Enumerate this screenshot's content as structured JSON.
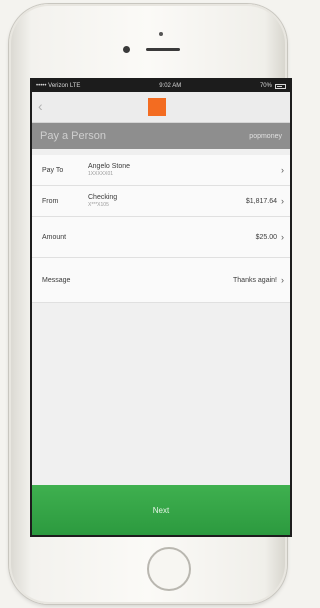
{
  "statusbar": {
    "carrier": "••••• Verizon LTE",
    "time": "9:02 AM",
    "battery": "70%"
  },
  "navbar": {
    "back_icon": "chevron-left-icon",
    "back_glyph": "‹"
  },
  "title": {
    "text": "Pay a Person",
    "brand": "popmoney"
  },
  "rows": [
    {
      "label": "Pay To",
      "value_main": "Angelo Stone",
      "value_sub": "1XXXXX01",
      "chevron": "›"
    },
    {
      "label": "From",
      "value_main": "Checking",
      "value_sub": "X***X105",
      "amount": "$1,817.64",
      "chevron": "›"
    },
    {
      "label": "Amount",
      "value": "$25.00",
      "chevron": "›"
    },
    {
      "label": "Message",
      "value": "Thanks again!",
      "chevron": "›"
    }
  ],
  "button": {
    "next_label": "Next"
  },
  "colors": {
    "brand_orange": "#f36c21",
    "next_green": "#35a646",
    "title_gray": "#8e8e8e"
  }
}
